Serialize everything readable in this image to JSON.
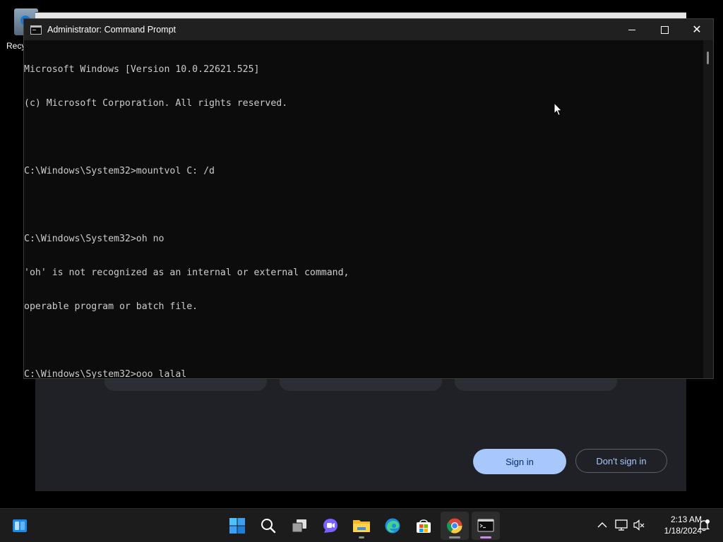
{
  "desktop": {
    "icons": [
      {
        "label": "Recy"
      }
    ]
  },
  "background_app": {
    "sign_in_label": "Sign in",
    "dont_sign_in_label": "Don't sign in"
  },
  "cmd": {
    "title": "Administrator: Command Prompt",
    "lines": [
      "Microsoft Windows [Version 10.0.22621.525]",
      "(c) Microsoft Corporation. All rights reserved.",
      "",
      "C:\\Windows\\System32>mountvol C: /d",
      "",
      "C:\\Windows\\System32>oh no",
      "'oh' is not recognized as an internal or external command,",
      "operable program or batch file.",
      "",
      "C:\\Windows\\System32>ooo lalal"
    ]
  },
  "taskbar": {
    "items": [
      {
        "name": "widgets-icon"
      },
      {
        "name": "start-icon"
      },
      {
        "name": "search-icon"
      },
      {
        "name": "task-view-icon"
      },
      {
        "name": "chat-icon"
      },
      {
        "name": "file-explorer-icon"
      },
      {
        "name": "edge-icon"
      },
      {
        "name": "store-icon"
      },
      {
        "name": "chrome-icon"
      },
      {
        "name": "terminal-icon"
      }
    ],
    "time": "2:13 AM",
    "date": "1/18/2024",
    "accent_color": "#c58ee5"
  },
  "colors": {
    "console_bg": "#0c0c0c",
    "console_text": "#cccccc",
    "sign_in_bg": "#a8c7fa"
  }
}
